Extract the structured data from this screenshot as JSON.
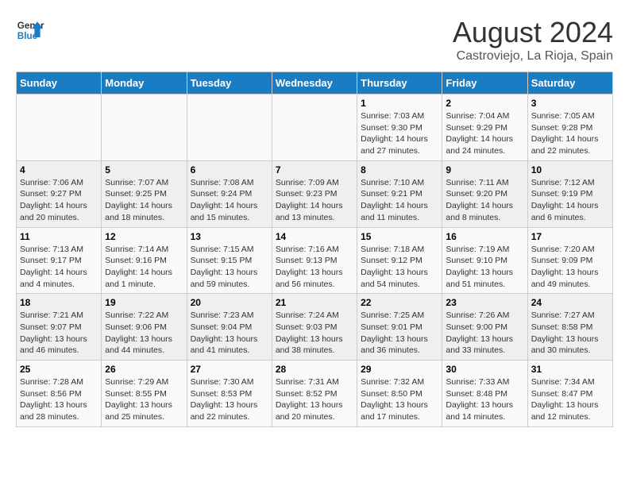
{
  "header": {
    "logo_line1": "General",
    "logo_line2": "Blue",
    "month_year": "August 2024",
    "location": "Castroviejo, La Rioja, Spain"
  },
  "weekdays": [
    "Sunday",
    "Monday",
    "Tuesday",
    "Wednesday",
    "Thursday",
    "Friday",
    "Saturday"
  ],
  "weeks": [
    [
      {
        "day": "",
        "info": ""
      },
      {
        "day": "",
        "info": ""
      },
      {
        "day": "",
        "info": ""
      },
      {
        "day": "",
        "info": ""
      },
      {
        "day": "1",
        "info": "Sunrise: 7:03 AM\nSunset: 9:30 PM\nDaylight: 14 hours\nand 27 minutes."
      },
      {
        "day": "2",
        "info": "Sunrise: 7:04 AM\nSunset: 9:29 PM\nDaylight: 14 hours\nand 24 minutes."
      },
      {
        "day": "3",
        "info": "Sunrise: 7:05 AM\nSunset: 9:28 PM\nDaylight: 14 hours\nand 22 minutes."
      }
    ],
    [
      {
        "day": "4",
        "info": "Sunrise: 7:06 AM\nSunset: 9:27 PM\nDaylight: 14 hours\nand 20 minutes."
      },
      {
        "day": "5",
        "info": "Sunrise: 7:07 AM\nSunset: 9:25 PM\nDaylight: 14 hours\nand 18 minutes."
      },
      {
        "day": "6",
        "info": "Sunrise: 7:08 AM\nSunset: 9:24 PM\nDaylight: 14 hours\nand 15 minutes."
      },
      {
        "day": "7",
        "info": "Sunrise: 7:09 AM\nSunset: 9:23 PM\nDaylight: 14 hours\nand 13 minutes."
      },
      {
        "day": "8",
        "info": "Sunrise: 7:10 AM\nSunset: 9:21 PM\nDaylight: 14 hours\nand 11 minutes."
      },
      {
        "day": "9",
        "info": "Sunrise: 7:11 AM\nSunset: 9:20 PM\nDaylight: 14 hours\nand 8 minutes."
      },
      {
        "day": "10",
        "info": "Sunrise: 7:12 AM\nSunset: 9:19 PM\nDaylight: 14 hours\nand 6 minutes."
      }
    ],
    [
      {
        "day": "11",
        "info": "Sunrise: 7:13 AM\nSunset: 9:17 PM\nDaylight: 14 hours\nand 4 minutes."
      },
      {
        "day": "12",
        "info": "Sunrise: 7:14 AM\nSunset: 9:16 PM\nDaylight: 14 hours\nand 1 minute."
      },
      {
        "day": "13",
        "info": "Sunrise: 7:15 AM\nSunset: 9:15 PM\nDaylight: 13 hours\nand 59 minutes."
      },
      {
        "day": "14",
        "info": "Sunrise: 7:16 AM\nSunset: 9:13 PM\nDaylight: 13 hours\nand 56 minutes."
      },
      {
        "day": "15",
        "info": "Sunrise: 7:18 AM\nSunset: 9:12 PM\nDaylight: 13 hours\nand 54 minutes."
      },
      {
        "day": "16",
        "info": "Sunrise: 7:19 AM\nSunset: 9:10 PM\nDaylight: 13 hours\nand 51 minutes."
      },
      {
        "day": "17",
        "info": "Sunrise: 7:20 AM\nSunset: 9:09 PM\nDaylight: 13 hours\nand 49 minutes."
      }
    ],
    [
      {
        "day": "18",
        "info": "Sunrise: 7:21 AM\nSunset: 9:07 PM\nDaylight: 13 hours\nand 46 minutes."
      },
      {
        "day": "19",
        "info": "Sunrise: 7:22 AM\nSunset: 9:06 PM\nDaylight: 13 hours\nand 44 minutes."
      },
      {
        "day": "20",
        "info": "Sunrise: 7:23 AM\nSunset: 9:04 PM\nDaylight: 13 hours\nand 41 minutes."
      },
      {
        "day": "21",
        "info": "Sunrise: 7:24 AM\nSunset: 9:03 PM\nDaylight: 13 hours\nand 38 minutes."
      },
      {
        "day": "22",
        "info": "Sunrise: 7:25 AM\nSunset: 9:01 PM\nDaylight: 13 hours\nand 36 minutes."
      },
      {
        "day": "23",
        "info": "Sunrise: 7:26 AM\nSunset: 9:00 PM\nDaylight: 13 hours\nand 33 minutes."
      },
      {
        "day": "24",
        "info": "Sunrise: 7:27 AM\nSunset: 8:58 PM\nDaylight: 13 hours\nand 30 minutes."
      }
    ],
    [
      {
        "day": "25",
        "info": "Sunrise: 7:28 AM\nSunset: 8:56 PM\nDaylight: 13 hours\nand 28 minutes."
      },
      {
        "day": "26",
        "info": "Sunrise: 7:29 AM\nSunset: 8:55 PM\nDaylight: 13 hours\nand 25 minutes."
      },
      {
        "day": "27",
        "info": "Sunrise: 7:30 AM\nSunset: 8:53 PM\nDaylight: 13 hours\nand 22 minutes."
      },
      {
        "day": "28",
        "info": "Sunrise: 7:31 AM\nSunset: 8:52 PM\nDaylight: 13 hours\nand 20 minutes."
      },
      {
        "day": "29",
        "info": "Sunrise: 7:32 AM\nSunset: 8:50 PM\nDaylight: 13 hours\nand 17 minutes."
      },
      {
        "day": "30",
        "info": "Sunrise: 7:33 AM\nSunset: 8:48 PM\nDaylight: 13 hours\nand 14 minutes."
      },
      {
        "day": "31",
        "info": "Sunrise: 7:34 AM\nSunset: 8:47 PM\nDaylight: 13 hours\nand 12 minutes."
      }
    ]
  ]
}
